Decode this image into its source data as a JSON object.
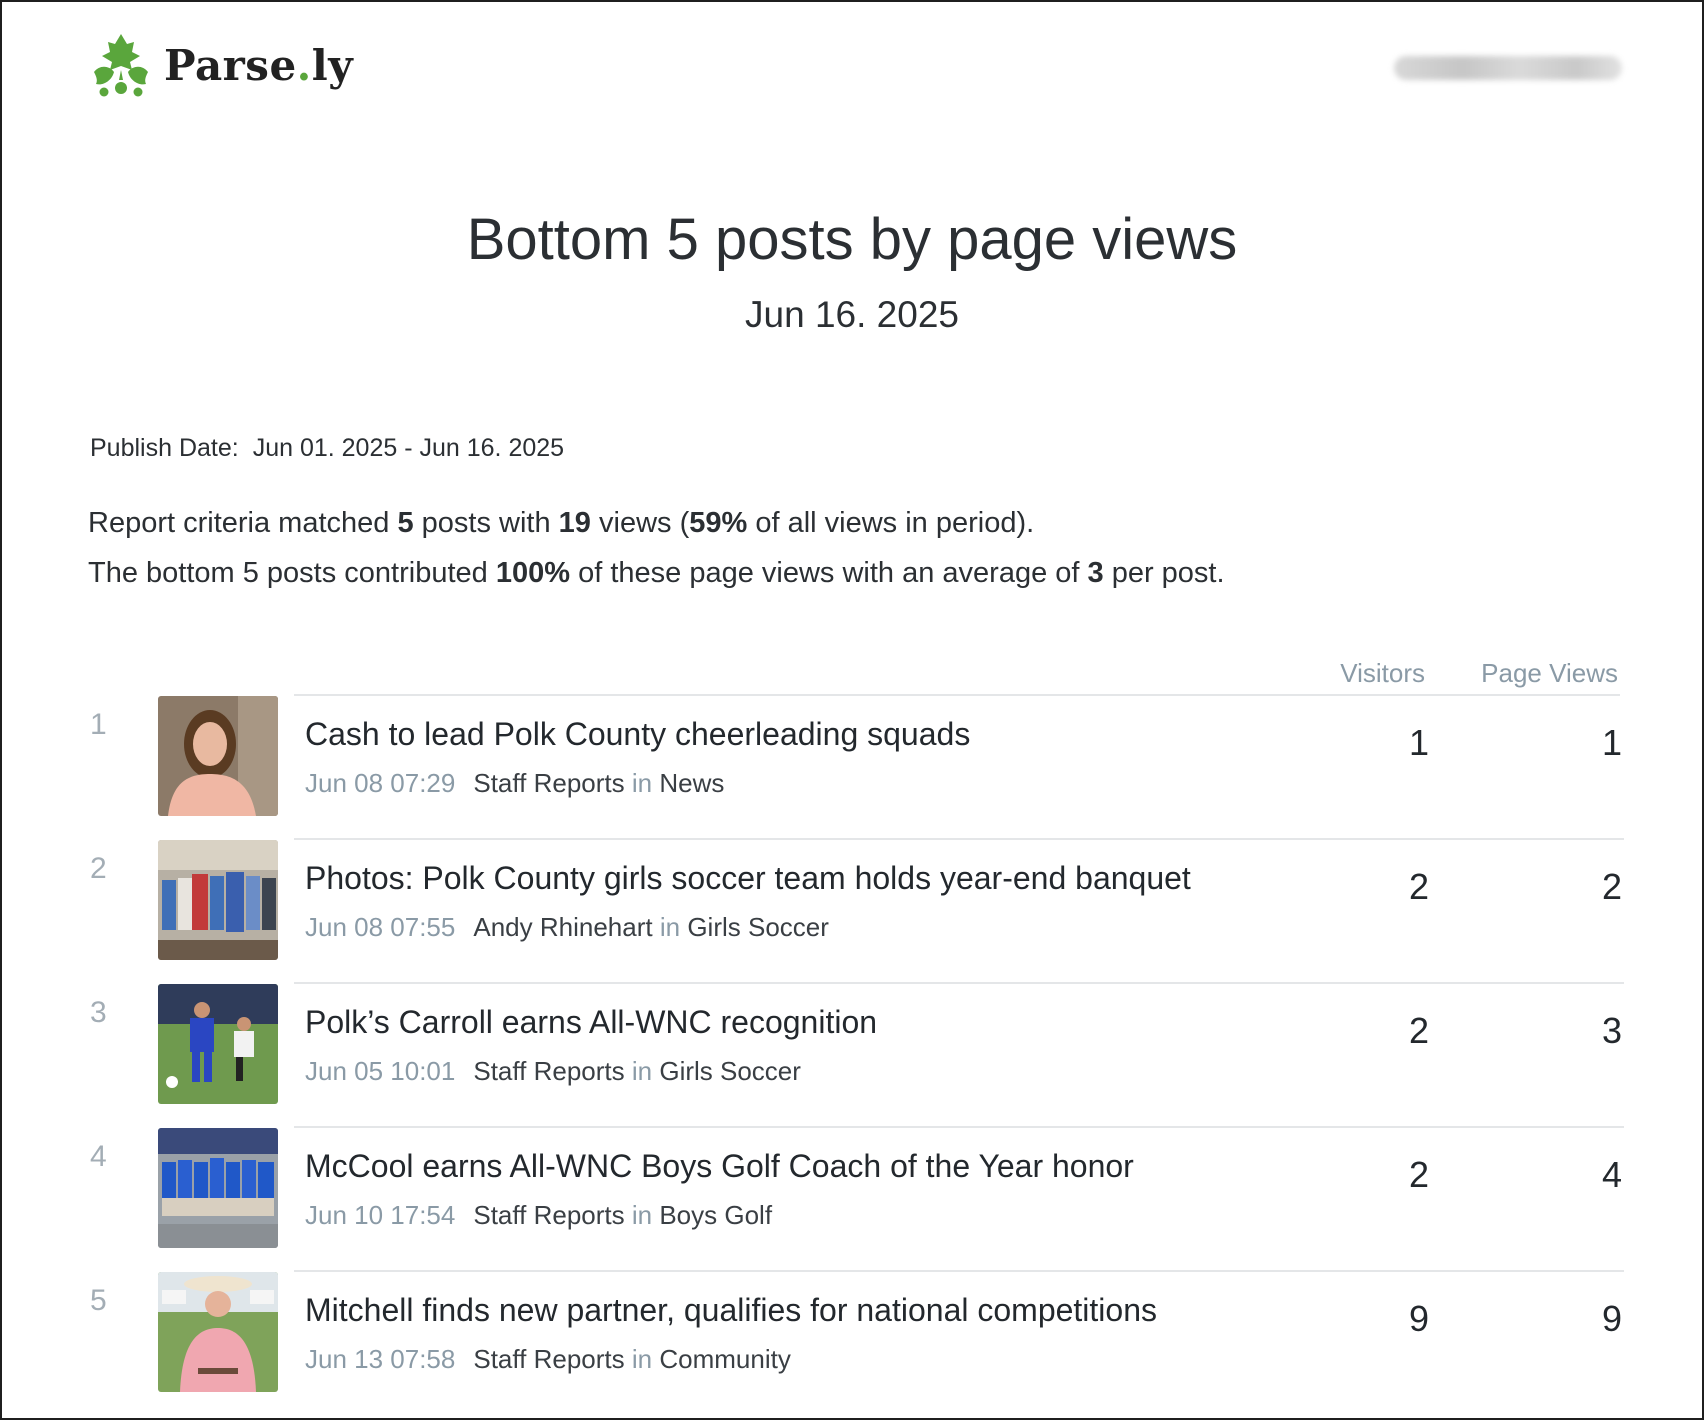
{
  "brand": {
    "name_main": "Parse",
    "name_dot": ".",
    "name_end": "ly",
    "accent": "#5aa63c",
    "icon": "parsely-leaf-icon"
  },
  "report": {
    "title": "Bottom 5 posts by page views",
    "date": "Jun 16. 2025",
    "publish_label": "Publish Date:",
    "publish_range": "Jun 01. 2025 - Jun 16. 2025"
  },
  "summary": {
    "line1": {
      "t1": "Report criteria matched ",
      "posts": "5",
      "t2": " posts with ",
      "views": "19",
      "t3": " views (",
      "pct": "59%",
      "t4": " of all views in period)."
    },
    "line2": {
      "t1": "The bottom 5 posts contributed ",
      "pct": "100%",
      "t2": " of these page views with an average of ",
      "avg": "3",
      "t3": " per post."
    }
  },
  "columns": {
    "visitors": "Visitors",
    "page_views": "Page Views"
  },
  "posts": [
    {
      "rank": "1",
      "title": "Cash to lead Polk County cheerleading squads",
      "time": "Jun 08 07:29",
      "author": "Staff Reports",
      "in": "in",
      "section": "News",
      "visitors": "1",
      "page_views": "1"
    },
    {
      "rank": "2",
      "title": "Photos: Polk County girls soccer team holds year-end banquet",
      "time": "Jun 08 07:55",
      "author": "Andy Rhinehart",
      "in": "in",
      "section": "Girls Soccer",
      "visitors": "2",
      "page_views": "2"
    },
    {
      "rank": "3",
      "title": "Polk’s Carroll earns All-WNC recognition",
      "time": "Jun 05 10:01",
      "author": "Staff Reports",
      "in": "in",
      "section": "Girls Soccer",
      "visitors": "2",
      "page_views": "3"
    },
    {
      "rank": "4",
      "title": "McCool earns All-WNC Boys Golf Coach of the Year honor",
      "time": "Jun 10 17:54",
      "author": "Staff Reports",
      "in": "in",
      "section": "Boys Golf",
      "visitors": "2",
      "page_views": "4"
    },
    {
      "rank": "5",
      "title": "Mitchell finds new partner, qualifies for national competitions",
      "time": "Jun 13 07:58",
      "author": "Staff Reports",
      "in": "in",
      "section": "Community",
      "visitors": "9",
      "page_views": "9"
    }
  ]
}
